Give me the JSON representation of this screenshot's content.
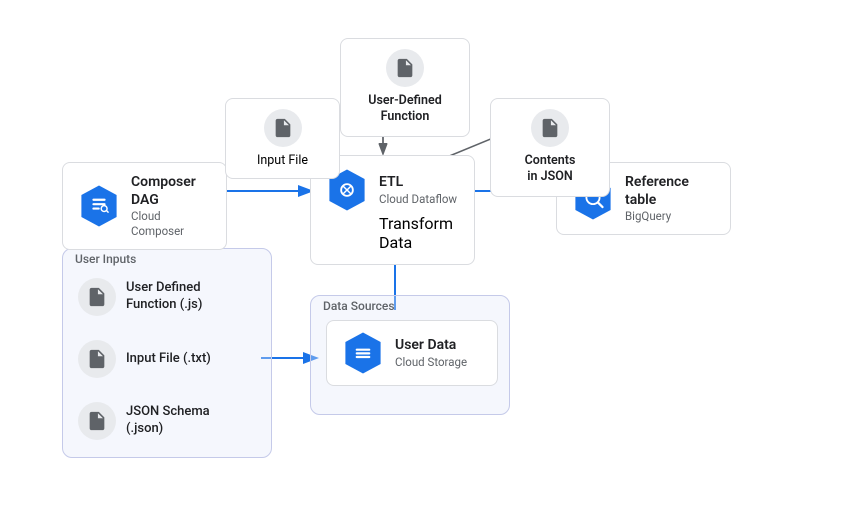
{
  "nodes": {
    "composer_dag": {
      "title": "Composer DAG",
      "subtitle": "Cloud Composer"
    },
    "etl": {
      "title": "ETL",
      "subtitle": "Cloud Dataflow",
      "sub2": "Transform Data"
    },
    "reference_table": {
      "title": "Reference table",
      "subtitle": "BigQuery"
    },
    "user_defined_function": {
      "label_line1": "User-Defined",
      "label_line2": "Function"
    },
    "input_file": {
      "label": "Input File"
    },
    "contents_json": {
      "label_line1": "Contents",
      "label_line2": "in JSON"
    },
    "user_data": {
      "title": "User Data",
      "subtitle": "Cloud Storage"
    }
  },
  "groups": {
    "user_inputs": {
      "label": "User Inputs",
      "items": [
        {
          "label_line1": "User Defined",
          "label_line2": "Function (.js)"
        },
        {
          "label_line1": "Input File (.txt)",
          "label_line2": ""
        },
        {
          "label_line1": "JSON Schema",
          "label_line2": "(.json)"
        }
      ]
    },
    "data_sources": {
      "label": "Data Sources"
    }
  },
  "colors": {
    "blue_hex": "#1a73e8",
    "blue_dark_hex": "#1558b0",
    "grey_icon": "#e8eaed",
    "border": "#dadce0"
  }
}
